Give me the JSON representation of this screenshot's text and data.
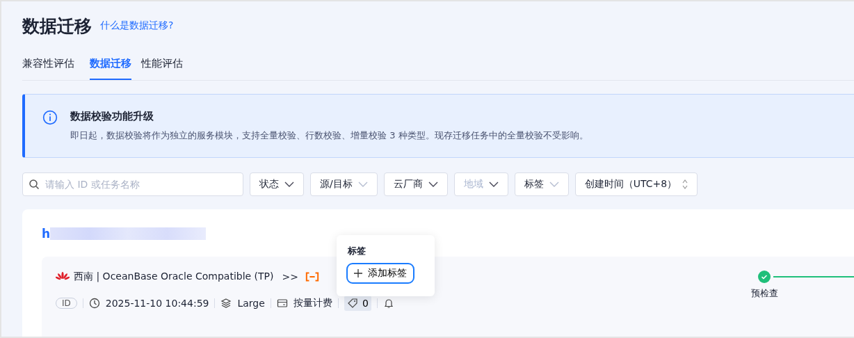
{
  "page": {
    "title": "数据迁移",
    "help_link": "什么是数据迁移?"
  },
  "tabs": [
    {
      "label": "兼容性评估",
      "selected": false
    },
    {
      "label": "数据迁移",
      "selected": true
    },
    {
      "label": "性能评估",
      "selected": false
    }
  ],
  "notice": {
    "title": "数据校验功能升级",
    "text": "即日起，数据校验将作为独立的服务模块，支持全量校验、行数校验、增量校验 3 种类型。现存迁移任务中的全量校验不受影响。"
  },
  "search": {
    "placeholder": "请输入 ID 或任务名称"
  },
  "filters": [
    {
      "label": "状态",
      "kind": "dropdown",
      "disabled": false
    },
    {
      "label": "源/目标",
      "kind": "dropdown",
      "disabled": false
    },
    {
      "label": "云厂商",
      "kind": "dropdown",
      "disabled": false
    },
    {
      "label": "地域",
      "kind": "dropdown",
      "disabled": true
    },
    {
      "label": "标签",
      "kind": "dropdown",
      "disabled": false
    },
    {
      "label": "创建时间（UTC+8）",
      "kind": "sort",
      "disabled": false
    }
  ],
  "task": {
    "name": "h",
    "route": "西南 | OceanBase Oracle Compatible (TP)",
    "arrow": ">>",
    "id_badge": "ID",
    "created": "2025-11-10 10:44:59",
    "spec": "Large",
    "billing": "按量计费",
    "tag_count": "0",
    "steps": [
      {
        "label": "预检查",
        "done": true
      }
    ]
  },
  "tag_popover": {
    "title": "标签",
    "add_button": "添加标签"
  }
}
